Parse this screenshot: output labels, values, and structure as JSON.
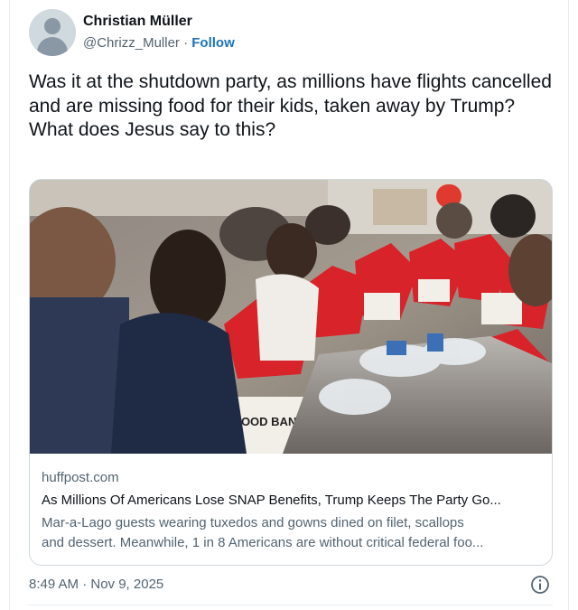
{
  "author": {
    "display_name": "Christian Müller",
    "handle": "@Chrizz_Muller",
    "separator": "·",
    "follow_label": "Follow"
  },
  "tweet": {
    "text": "Was it at the shutdown party, as millions have flights cancelled and are missing food for their kids, taken away by Trump?\nWhat does Jesus say to this?"
  },
  "link_card": {
    "image_description_icon": "photo-of-volunteers-packing-food-bags",
    "bag_print": "FOOD BANK",
    "domain": "huffpost.com",
    "title": "As Millions Of Americans Lose SNAP Benefits, Trump Keeps The Party Go...",
    "description_line1": "Mar-a-Lago guests wearing tuxedos and gowns dined on filet, scallops",
    "description_line2": "and dessert. Meanwhile, 1 in 8 Americans are without critical federal foo..."
  },
  "footer": {
    "timestamp": "8:49 AM · Nov 9, 2025",
    "info_icon": "info-icon"
  },
  "colors": {
    "link_blue": "#1d73b8",
    "secondary_text": "#536471",
    "border": "#cfd9de",
    "bag_red": "#d8232a"
  }
}
